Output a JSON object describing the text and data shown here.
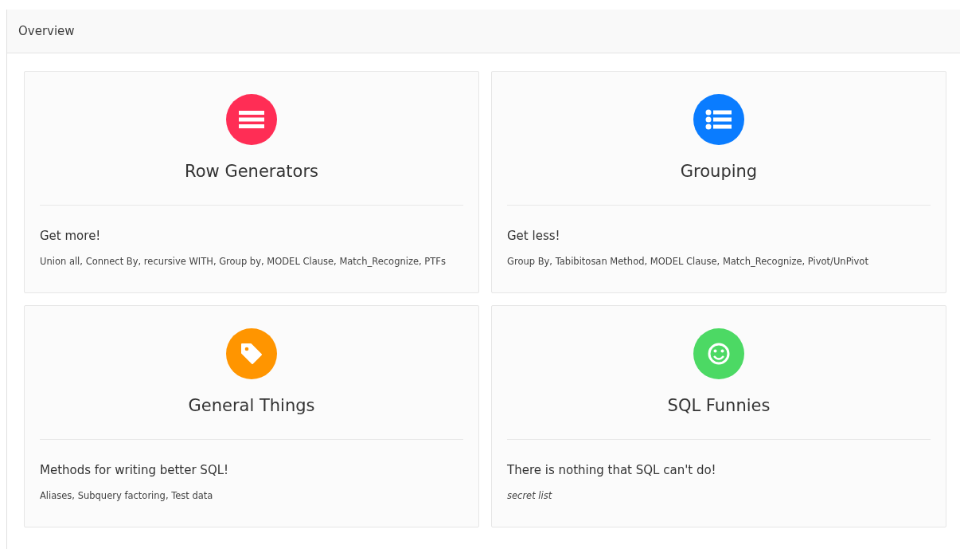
{
  "region": {
    "title": "Overview"
  },
  "cards": [
    {
      "kind": "menu",
      "color": "#ff2d55",
      "title": "Row Generators",
      "subtitle": "Get more!",
      "detail": "Union all, Connect By, recursive WITH, Group by, MODEL Clause, Match_Recognize, PTFs",
      "italic": false
    },
    {
      "kind": "list",
      "color": "#0a7cff",
      "title": "Grouping",
      "subtitle": "Get less!",
      "detail": "Group By, Tabibitosan Method, MODEL Clause, Match_Recognize, Pivot/UnPivot",
      "italic": false
    },
    {
      "kind": "tag",
      "color": "#ff9500",
      "title": "General Things",
      "subtitle": "Methods for writing better SQL!",
      "detail": "Aliases, Subquery factoring, Test data",
      "italic": false
    },
    {
      "kind": "smiley",
      "color": "#4cd964",
      "title": "SQL Funnies",
      "subtitle": "There is nothing that SQL can't do!",
      "detail": "secret list",
      "italic": true
    }
  ]
}
